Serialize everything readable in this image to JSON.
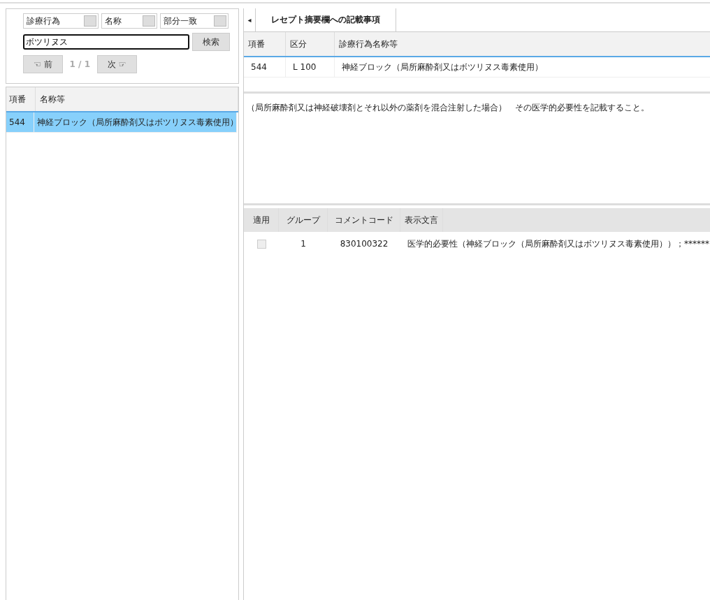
{
  "search": {
    "selects": [
      "診療行為",
      "名称",
      "部分一致"
    ],
    "query": "ボツリヌス",
    "search_button": "検索",
    "prev_button": "☜ 前",
    "page": "1 / 1",
    "next_button": "次 ☞"
  },
  "result_list": {
    "columns": [
      "項番",
      "名称等"
    ],
    "rows": [
      {
        "cells": [
          "544",
          "神経ブロック（局所麻酔剤又はボツリヌス毒素使用）"
        ],
        "selected": true
      }
    ]
  },
  "tab_strip": {
    "scroll_left": "◂",
    "tabs": [
      {
        "label": "レセプト摘要欄への記載事項",
        "selected": true
      }
    ]
  },
  "detail_table": {
    "columns": [
      "項番",
      "区分",
      "診療行為名称等"
    ],
    "rows": [
      [
        "544",
        "L 100",
        "神経ブロック（局所麻酔剤又はボツリヌス毒素使用）"
      ]
    ]
  },
  "note": "（局所麻酔剤又は神経破壊剤とそれ以外の薬剤を混合注射した場合）　その医学的必要性を記載すること。",
  "comment_table": {
    "columns": [
      "適用",
      "グループ",
      "コメントコード",
      "表示文言"
    ],
    "rows": [
      {
        "checked": false,
        "group": "1",
        "code": "830100322",
        "text": "医学的必要性（神経ブロック（局所麻酔剤又はボツリヌス毒素使用））；******"
      }
    ]
  }
}
